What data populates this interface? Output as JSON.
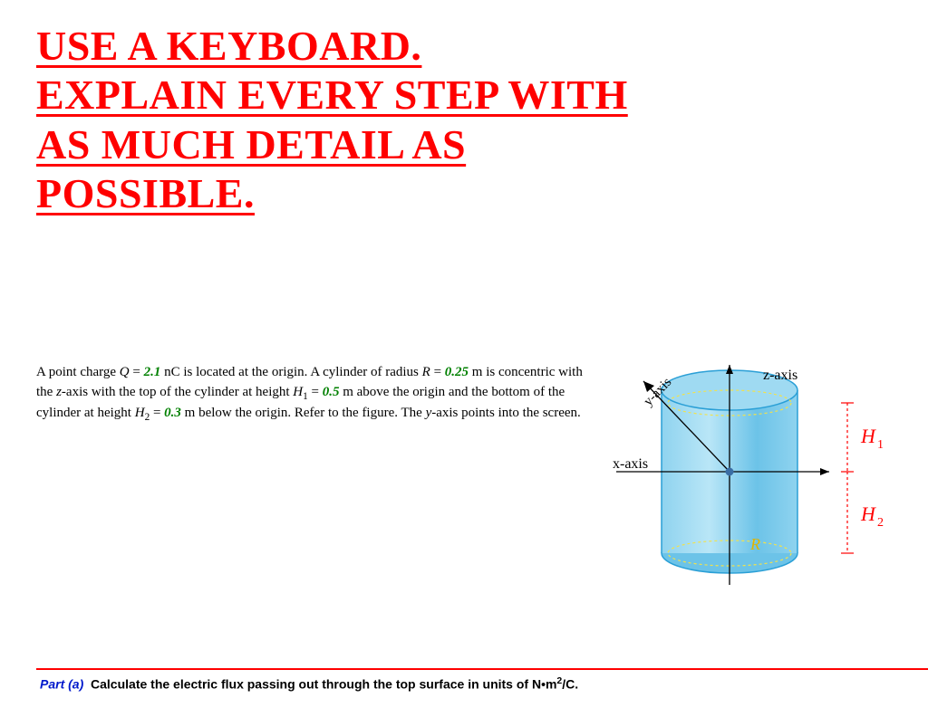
{
  "headline": {
    "line1": "USE A KEYBOARD.",
    "line2": "EXPLAIN EVERY STEP WITH",
    "line3": "AS MUCH DETAIL AS",
    "line4": "POSSIBLE."
  },
  "problem": {
    "pre_Q": "A point charge ",
    "Q_sym": "Q",
    "eq": " = ",
    "Q_val": "2.1",
    "Q_unit": " nC is located at the origin. A cylinder of radius ",
    "R_sym": "R",
    "R_val": "0.25",
    "after_R": " m is concentric with the ",
    "z_axis": "z",
    "mid1": "-axis with the top of the cylinder at height ",
    "H1_sym": "H",
    "H1_sub": "1",
    "H1_val": "0.5",
    "mid2": " m above the origin and the bottom of the cylinder at height ",
    "H2_sym": "H",
    "H2_sub": "2",
    "H2_val": "0.3",
    "mid3": " m below the origin. Refer to the figure. The ",
    "y_axis": "y",
    "tail": "-axis points into the screen."
  },
  "diagram": {
    "z_label": "z-axis",
    "y_label": "y-axis",
    "x_label": "x-axis",
    "R_label": "R",
    "H1_label": "H",
    "H1_sub": "1",
    "H2_label": "H",
    "H2_sub": "2"
  },
  "part_a": {
    "label": "Part (a)",
    "text_pre": "Calculate the electric flux passing out through the top surface in units of N•m",
    "exp": "2",
    "text_post": "/C."
  }
}
